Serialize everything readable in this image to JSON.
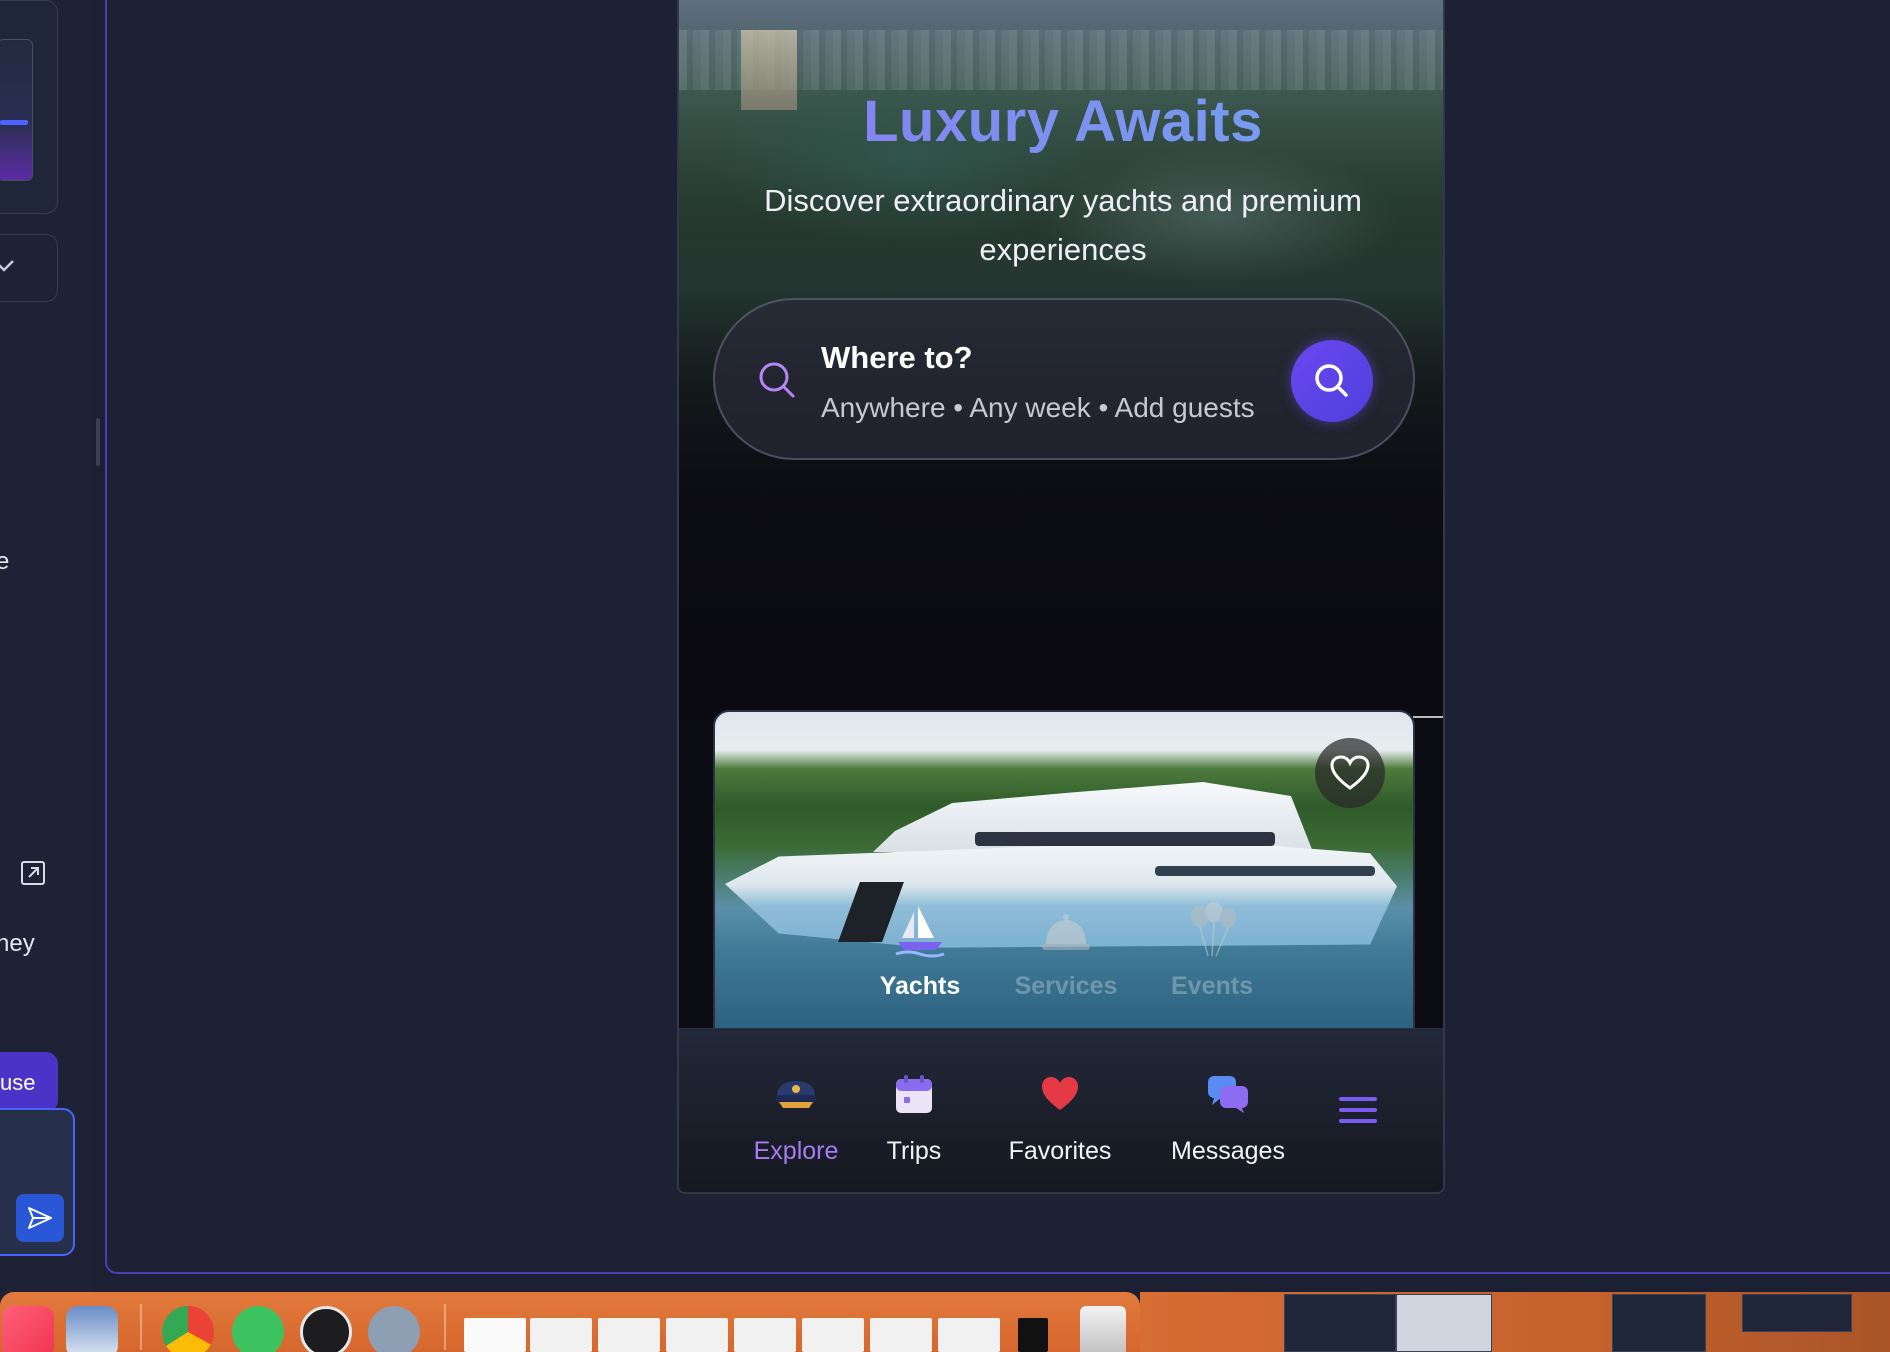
{
  "sidebar": {
    "edge_text_1": "e",
    "edge_text_2": "hey",
    "use_button": "use"
  },
  "hero": {
    "title": "Luxury Awaits",
    "subtitle": "Discover extraordinary yachts and premium experiences"
  },
  "search": {
    "title": "Where to?",
    "meta": "Anywhere • Any week • Add guests"
  },
  "categories": [
    {
      "label": "Yachts",
      "icon": "sailboat-icon",
      "active": true
    },
    {
      "label": "Services",
      "icon": "service-bell-icon",
      "active": false
    },
    {
      "label": "Events",
      "icon": "balloons-icon",
      "active": false
    }
  ],
  "nav": {
    "explore": "Explore",
    "trips": "Trips",
    "favorites": "Favorites",
    "messages": "Messages"
  },
  "colors": {
    "accent": "#6a48f0",
    "active_nav": "#a97bf0",
    "background": "#1b2132",
    "dock": "#e27a3c"
  }
}
